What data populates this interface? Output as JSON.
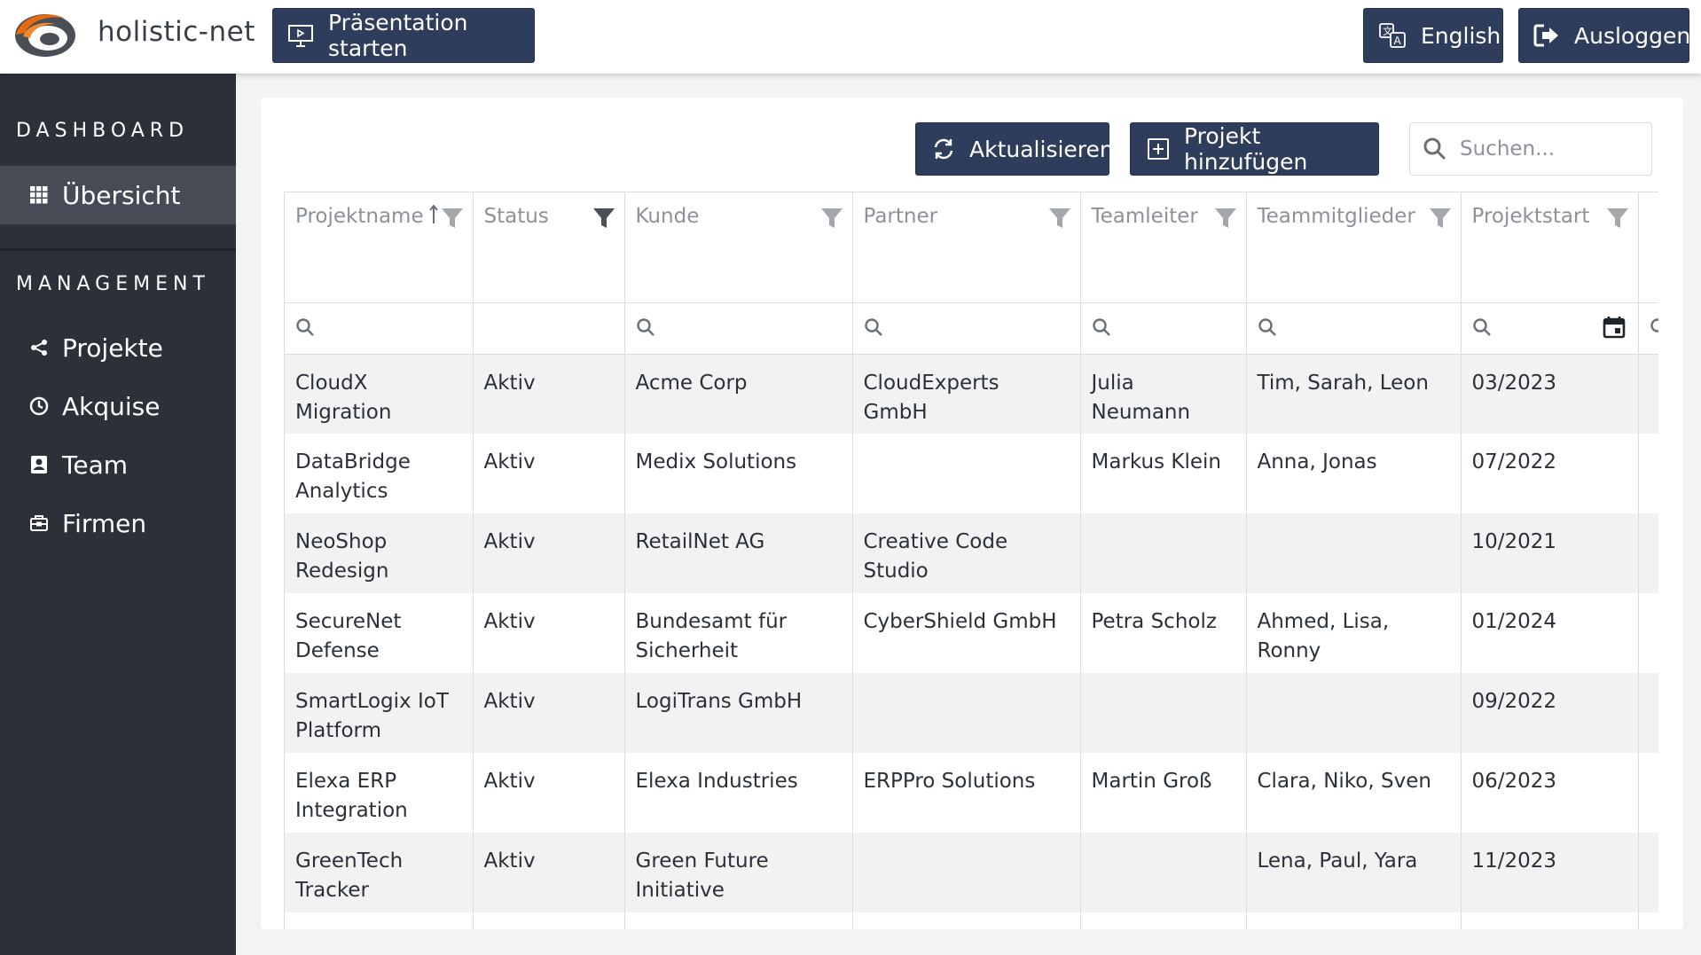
{
  "header": {
    "brand": "holistic-net",
    "present_label": "Präsentation starten",
    "language_label": "English",
    "logout_label": "Ausloggen"
  },
  "sidebar": {
    "dashboard_title": "DASHBOARD",
    "management_title": "MANAGEMENT",
    "dashboard_items": [
      {
        "label": "Übersicht",
        "icon": "grid-icon",
        "active": true
      }
    ],
    "management_items": [
      {
        "label": "Projekte",
        "icon": "share-icon"
      },
      {
        "label": "Akquise",
        "icon": "clock-icon"
      },
      {
        "label": "Team",
        "icon": "id-badge-icon"
      },
      {
        "label": "Firmen",
        "icon": "briefcase-icon"
      }
    ]
  },
  "toolbar": {
    "refresh_label": "Aktualisieren",
    "add_label": "Projekt hinzufügen",
    "search_placeholder": "Suchen..."
  },
  "table": {
    "columns": [
      "Projektname",
      "Status",
      "Kunde",
      "Partner",
      "Teamleiter",
      "Teammitglieder",
      "Projektstart",
      ""
    ],
    "sorted_column": "Projektname",
    "rows": [
      [
        "CloudX Migration",
        "Aktiv",
        "Acme Corp",
        "CloudExperts GmbH",
        "Julia Neumann",
        "Tim, Sarah, Leon",
        "03/2023",
        ""
      ],
      [
        "DataBridge Analytics",
        "Aktiv",
        "Medix Solutions",
        "",
        "Markus Klein",
        "Anna, Jonas",
        "07/2022",
        ""
      ],
      [
        "NeoShop Redesign",
        "Aktiv",
        "RetailNet AG",
        "Creative Code Studio",
        "",
        "",
        "10/2021",
        ""
      ],
      [
        "SecureNet Defense",
        "Aktiv",
        "Bundesamt für Sicherheit",
        "CyberShield GmbH",
        "Petra Scholz",
        "Ahmed, Lisa, Ronny",
        "01/2024",
        ""
      ],
      [
        "SmartLogix IoT Platform",
        "Aktiv",
        "LogiTrans GmbH",
        "",
        "",
        "",
        "09/2022",
        ""
      ],
      [
        "Elexa ERP Integration",
        "Aktiv",
        "Elexa Industries",
        "ERPPro Solutions",
        "Martin Groß",
        "Clara, Niko, Sven",
        "06/2023",
        ""
      ],
      [
        "GreenTech Tracker",
        "Aktiv",
        "Green Future Initiative",
        "",
        "",
        "Lena, Paul, Yara",
        "11/2023",
        ""
      ],
      [
        "",
        "",
        "",
        "",
        "",
        "",
        "",
        ""
      ]
    ]
  },
  "colors": {
    "sidebar_bg": "#2b3039",
    "button_bg": "#2f3d5c",
    "logo_orange": "#e86a10"
  }
}
